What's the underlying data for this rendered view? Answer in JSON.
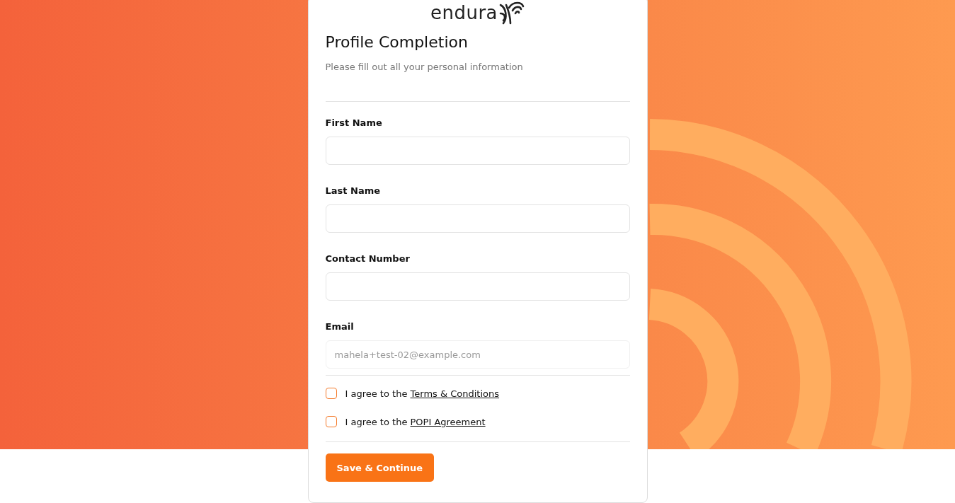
{
  "logo": {
    "text": "endura"
  },
  "form": {
    "title": "Profile Completion",
    "subtitle": "Please fill out all your personal information",
    "fields": [
      {
        "label": "First Name",
        "disabled": false
      },
      {
        "label": "Last Name",
        "disabled": false
      },
      {
        "label": "Contact Number",
        "disabled": false
      },
      {
        "label": "Email",
        "value": "mahela+test-02@example.com",
        "disabled": true
      }
    ],
    "agreements": [
      {
        "text": "I agree to the",
        "link": "Terms & Conditions",
        "checked": false
      },
      {
        "text": "I agree to the",
        "link": "POPI Agreement",
        "checked": false
      }
    ],
    "submit": "Save & Continue"
  }
}
